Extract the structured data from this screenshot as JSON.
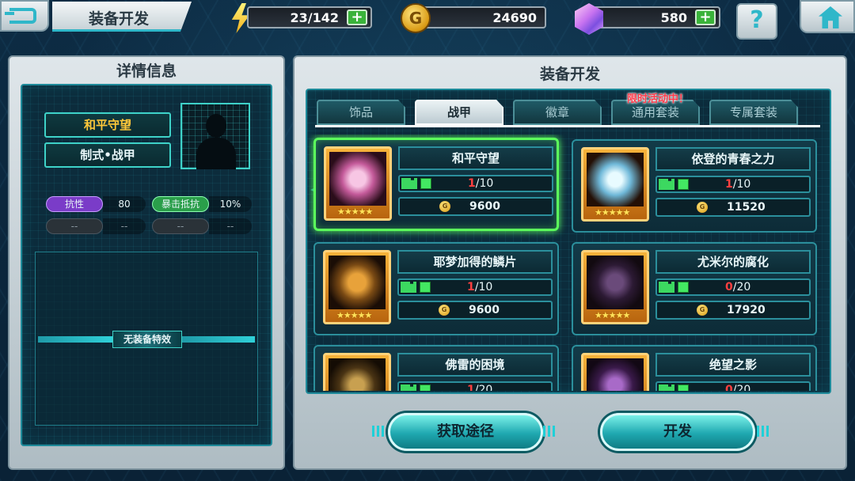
{
  "topbar": {
    "page_title": "装备开发",
    "stamina": "23/142",
    "gold": "24690",
    "gem": "580",
    "plus": "+",
    "help": "?",
    "coin_letter": "G"
  },
  "icons": {
    "back": "back-arrow-icon",
    "stamina": "lightning-bolt-icon",
    "gold": "gold-coin-icon",
    "gem": "crystal-gem-icon",
    "help": "question-mark-icon",
    "home": "home-icon"
  },
  "detail_panel": {
    "title": "详情信息",
    "item_name": "和平守望",
    "item_type": "制式•战甲",
    "stats": [
      {
        "label": "抗性",
        "value": "80"
      },
      {
        "label": "暴击抵抗",
        "value": "10%"
      },
      {
        "label": "--",
        "value": "--"
      },
      {
        "label": "--",
        "value": "--"
      }
    ],
    "no_effect": "无装备特效"
  },
  "dev_panel": {
    "title": "装备开发",
    "tabs": [
      {
        "label": "饰品",
        "active": false
      },
      {
        "label": "战甲",
        "active": true
      },
      {
        "label": "徽章",
        "active": false
      },
      {
        "label": "通用套装",
        "active": false
      },
      {
        "label": "专属套装",
        "active": false
      }
    ],
    "event_badge": "限时活动中！",
    "items": [
      {
        "name": "和平守望",
        "current": "1",
        "total": "/10",
        "cost": "9600",
        "stars": "★★★★★",
        "selected": true
      },
      {
        "name": "依登的青春之力",
        "current": "1",
        "total": "/10",
        "cost": "11520",
        "stars": "★★★★★",
        "selected": false
      },
      {
        "name": "耶梦加得的鳞片",
        "current": "1",
        "total": "/10",
        "cost": "9600",
        "stars": "★★★★★",
        "selected": false
      },
      {
        "name": "尤米尔的腐化",
        "current": "0",
        "total": "/20",
        "cost": "17920",
        "stars": "★★★★★",
        "selected": false
      },
      {
        "name": "佛雷的困境",
        "current": "1",
        "total": "/20",
        "cost": "",
        "stars": "★★★★★",
        "selected": false
      },
      {
        "name": "绝望之影",
        "current": "0",
        "total": "/20",
        "cost": "",
        "stars": "★★★★★",
        "selected": false
      }
    ],
    "obtain_button": "获取途径",
    "develop_button": "开发"
  },
  "colors": {
    "accent": "#2fb7c9",
    "selected_glow": "#5cff5c",
    "fragment_low": "#ff4040",
    "event_red": "#ff3a4a"
  }
}
